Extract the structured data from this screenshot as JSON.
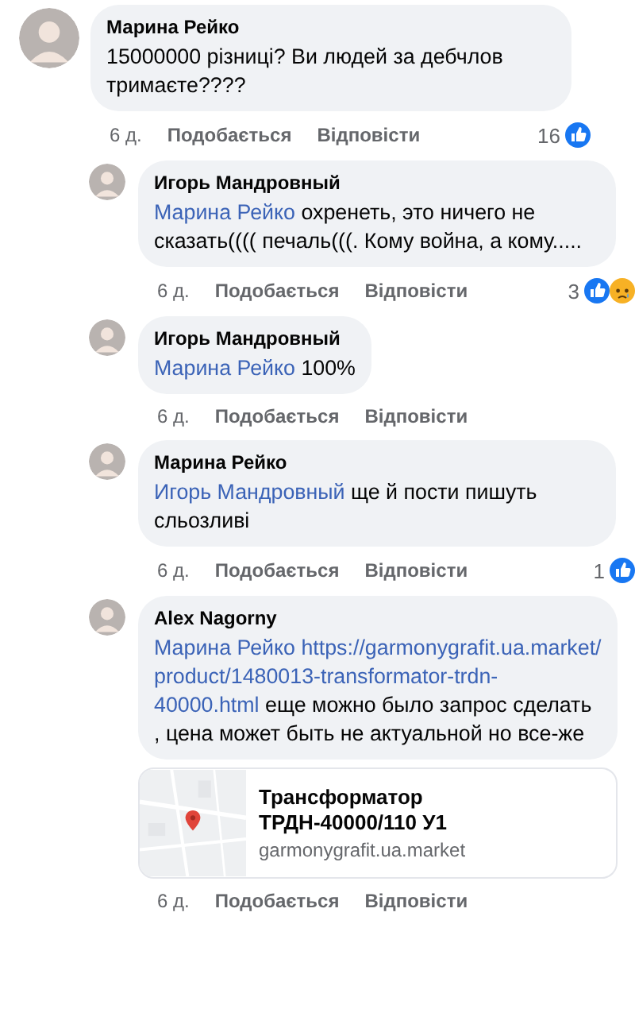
{
  "comments": [
    {
      "author": "Марина Рейко",
      "kind": "top",
      "body": [
        {
          "kind": "text",
          "text": "15000000 різниці? Ви людей за дебчлов тримаєте????"
        }
      ],
      "time": "6 д.",
      "like": "Подобається",
      "reply": "Відповісти",
      "reactions": {
        "count": "16",
        "icons": [
          {
            "kind": "like"
          }
        ]
      }
    },
    {
      "author": "Игорь Мандровный",
      "kind": "reply",
      "body": [
        {
          "kind": "mention",
          "text": "Марина Рейко"
        },
        {
          "kind": "text",
          "text": "охренеть, это ничего не сказать(((( печаль(((. Кому война, а кому....."
        }
      ],
      "time": "6 д.",
      "like": "Подобається",
      "reply": "Відповісти",
      "reactions": {
        "count": "3",
        "icons": [
          {
            "kind": "like"
          },
          {
            "kind": "sad"
          }
        ]
      }
    },
    {
      "author": "Игорь Мандровный",
      "kind": "reply",
      "body": [
        {
          "kind": "mention",
          "text": "Марина Рейко"
        },
        {
          "kind": "text",
          "text": "100%"
        }
      ],
      "time": "6 д.",
      "like": "Подобається",
      "reply": "Відповісти"
    },
    {
      "author": "Марина Рейко",
      "kind": "reply",
      "body": [
        {
          "kind": "mention",
          "text": "Игорь Мандровный"
        },
        {
          "kind": "text",
          "text": "ще й пости пишуть сльозливі"
        }
      ],
      "time": "6 д.",
      "like": "Подобається",
      "reply": "Відповісти",
      "reactions": {
        "count": "1",
        "icons": [
          {
            "kind": "like"
          }
        ]
      }
    },
    {
      "author": "Alex Nagorny",
      "kind": "reply",
      "body": [
        {
          "kind": "mention",
          "text": "Марина Рейко"
        },
        {
          "kind": "link",
          "text": "https://garmonygrafit.ua.market/product/1480013-transformator-trdn-40000.html"
        },
        {
          "kind": "text",
          "text": "еще можно было запрос сделать , цена может быть не актуальной но все-же"
        }
      ],
      "preview": {
        "kind": "picture",
        "title": "Трансформатор ТРДН-40000/110 У1",
        "domain": "garmonygrafit.ua.market"
      },
      "time": "6 д.",
      "like": "Подобається",
      "reply": "Відповісти"
    }
  ]
}
